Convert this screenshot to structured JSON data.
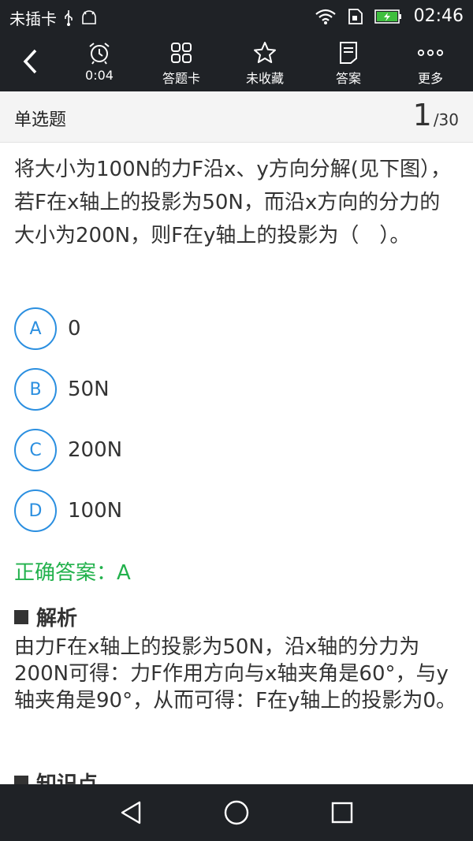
{
  "status_bar": {
    "carrier": "未插卡",
    "time": "02:46",
    "icons": [
      "usb-icon",
      "android-debug-icon",
      "wifi-icon",
      "sim-icon",
      "battery-charging-icon"
    ]
  },
  "toolbar": {
    "back_icon": "back-arrow-icon",
    "items": [
      {
        "icon": "alarm-clock-icon",
        "label": "0:04"
      },
      {
        "icon": "grid-icon",
        "label": "答题卡"
      },
      {
        "icon": "star-icon",
        "label": "未收藏"
      },
      {
        "icon": "document-icon",
        "label": "答案"
      },
      {
        "icon": "more-icon",
        "label": "更多"
      }
    ]
  },
  "question_header": {
    "type": "单选题",
    "current": "1",
    "total": "/30"
  },
  "question": {
    "text": "将大小为100N的力F沿x、y方向分解(见下图），若F在x轴上的投影为50N，而沿x方向的分力的大小为200N，则F在y轴上的投影为（　）。"
  },
  "options": [
    {
      "letter": "A",
      "text": "0"
    },
    {
      "letter": "B",
      "text": "50N"
    },
    {
      "letter": "C",
      "text": "200N"
    },
    {
      "letter": "D",
      "text": "100N"
    }
  ],
  "answer": {
    "text": "正确答案：A",
    "color": "#22b14c"
  },
  "analysis": {
    "title": "解析",
    "text": "由力F在x轴上的投影为50N，沿x轴的分力为200N可得：力F作用方向与x轴夹角是60°，与y轴夹角是90°，从而可得：F在y轴上的投影为0。"
  },
  "knowledge": {
    "title": "知识点"
  },
  "colors": {
    "bar_bg": "#1f2226",
    "accent": "#2b8fe0"
  },
  "nav_bar": {
    "icons": [
      "nav-back-icon",
      "nav-home-icon",
      "nav-recents-icon"
    ]
  }
}
